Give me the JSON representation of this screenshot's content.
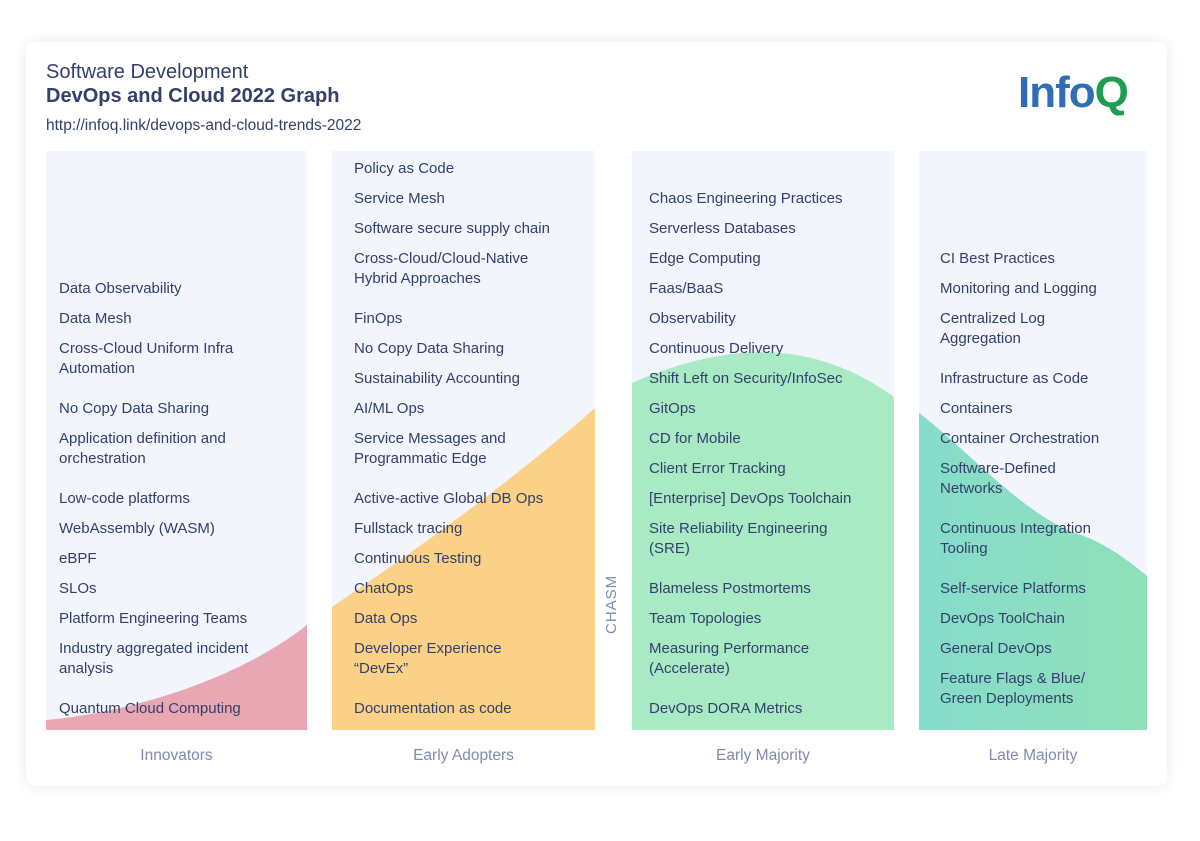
{
  "header": {
    "subtitle": "Software Development",
    "title": "DevOps and Cloud 2022 Graph",
    "url": "http://infoq.link/devops-and-cloud-trends-2022",
    "logo": {
      "part1": "Info",
      "part2": "Q",
      "color1": "#2f6db5",
      "color2": "#1e9e50"
    }
  },
  "chasm_label": "CHASM",
  "columns": [
    {
      "label": "Innovators",
      "curve_color": "#e9a7b3",
      "items": [
        "Data Observability",
        "Data Mesh",
        "Cross-Cloud Uniform Infra|Automation",
        "No Copy Data Sharing",
        "Application definition and|orchestration",
        "Low-code platforms",
        "WebAssembly (WASM)",
        "eBPF",
        "SLOs",
        "Platform Engineering Teams",
        "Industry aggregated incident|analysis",
        "Quantum Cloud Computing"
      ]
    },
    {
      "label": "Early Adopters",
      "curve_color": "#fbd187",
      "items": [
        "Policy as Code",
        "Service Mesh",
        "Software secure supply chain",
        "Cross-Cloud/Cloud-Native|Hybrid Approaches",
        "FinOps",
        "No Copy Data Sharing",
        "Sustainability Accounting",
        "AI/ML Ops",
        "Service Messages and|Programmatic Edge",
        "Active-active Global DB Ops",
        "Fullstack tracing",
        "Continuous Testing",
        "ChatOps",
        "Data Ops",
        "Developer Experience|“DevEx”",
        "Documentation as code"
      ]
    },
    {
      "label": "Early Majority",
      "curve_color": "#a8eac4",
      "items": [
        "Chaos Engineering Practices",
        "Serverless Databases",
        "Edge Computing",
        "Faas/BaaS",
        "Observability",
        "Continuous Delivery",
        "Shift Left on Security/InfoSec",
        "GitOps",
        "CD for Mobile",
        "Client Error Tracking",
        "[Enterprise] DevOps Toolchain",
        "Site Reliability Engineering|(SRE)",
        "Blameless Postmortems",
        "Team Topologies",
        "Measuring Performance|(Accelerate)",
        "DevOps DORA Metrics"
      ]
    },
    {
      "label": "Late Majority",
      "curve_color": "#8fdfbd",
      "items": [
        "CI Best Practices",
        "Monitoring and Logging",
        "Centralized Log|Aggregation",
        "Infrastructure as Code",
        "Containers",
        "Container Orchestration",
        "Software-Defined|Networks",
        "Continuous Integration|Tooling",
        "Self-service Platforms",
        "DevOps ToolChain",
        "General DevOps",
        "Feature Flags & Blue/|Green Deployments"
      ]
    }
  ]
}
